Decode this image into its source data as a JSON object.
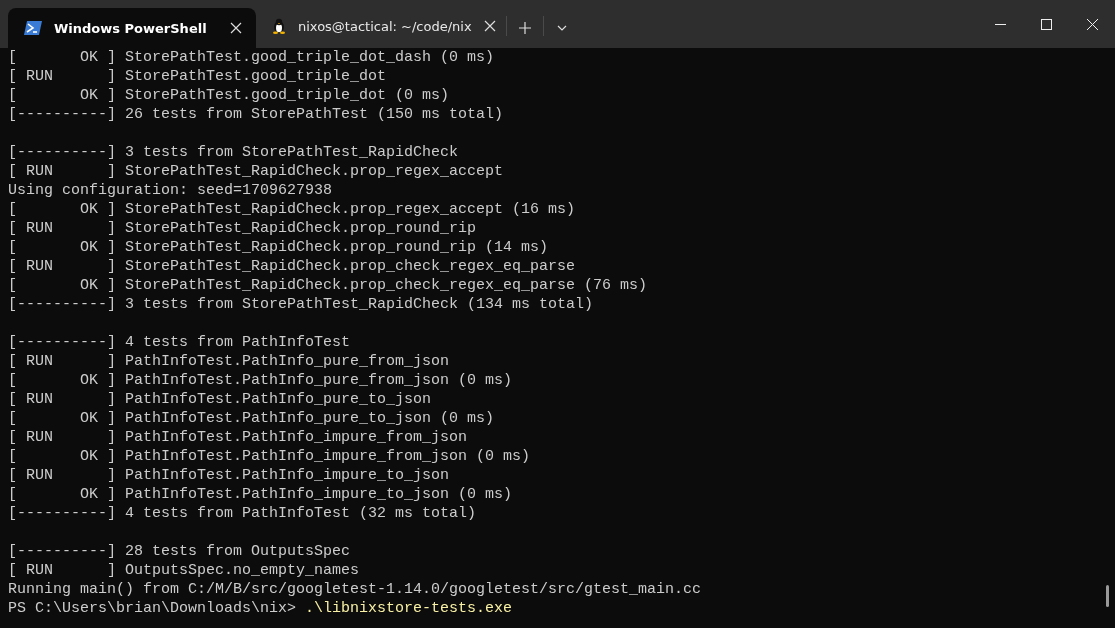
{
  "tabs": [
    {
      "title": "Windows PowerShell",
      "kind": "powershell",
      "selected": true
    },
    {
      "title": "nixos@tactical: ~/code/nix",
      "kind": "linux",
      "selected": false
    }
  ],
  "terminal": {
    "lines": [
      {
        "kind": "output",
        "text": "[       OK ] StorePathTest.good_triple_dot_dash (0 ms)"
      },
      {
        "kind": "output",
        "text": "[ RUN      ] StorePathTest.good_triple_dot"
      },
      {
        "kind": "output",
        "text": "[       OK ] StorePathTest.good_triple_dot (0 ms)"
      },
      {
        "kind": "output",
        "text": "[----------] 26 tests from StorePathTest (150 ms total)"
      },
      {
        "kind": "blank"
      },
      {
        "kind": "output",
        "text": "[----------] 3 tests from StorePathTest_RapidCheck"
      },
      {
        "kind": "output",
        "text": "[ RUN      ] StorePathTest_RapidCheck.prop_regex_accept"
      },
      {
        "kind": "output",
        "text": "Using configuration: seed=1709627938"
      },
      {
        "kind": "output",
        "text": "[       OK ] StorePathTest_RapidCheck.prop_regex_accept (16 ms)"
      },
      {
        "kind": "output",
        "text": "[ RUN      ] StorePathTest_RapidCheck.prop_round_rip"
      },
      {
        "kind": "output",
        "text": "[       OK ] StorePathTest_RapidCheck.prop_round_rip (14 ms)"
      },
      {
        "kind": "output",
        "text": "[ RUN      ] StorePathTest_RapidCheck.prop_check_regex_eq_parse"
      },
      {
        "kind": "output",
        "text": "[       OK ] StorePathTest_RapidCheck.prop_check_regex_eq_parse (76 ms)"
      },
      {
        "kind": "output",
        "text": "[----------] 3 tests from StorePathTest_RapidCheck (134 ms total)"
      },
      {
        "kind": "blank"
      },
      {
        "kind": "output",
        "text": "[----------] 4 tests from PathInfoTest"
      },
      {
        "kind": "output",
        "text": "[ RUN      ] PathInfoTest.PathInfo_pure_from_json"
      },
      {
        "kind": "output",
        "text": "[       OK ] PathInfoTest.PathInfo_pure_from_json (0 ms)"
      },
      {
        "kind": "output",
        "text": "[ RUN      ] PathInfoTest.PathInfo_pure_to_json"
      },
      {
        "kind": "output",
        "text": "[       OK ] PathInfoTest.PathInfo_pure_to_json (0 ms)"
      },
      {
        "kind": "output",
        "text": "[ RUN      ] PathInfoTest.PathInfo_impure_from_json"
      },
      {
        "kind": "output",
        "text": "[       OK ] PathInfoTest.PathInfo_impure_from_json (0 ms)"
      },
      {
        "kind": "output",
        "text": "[ RUN      ] PathInfoTest.PathInfo_impure_to_json"
      },
      {
        "kind": "output",
        "text": "[       OK ] PathInfoTest.PathInfo_impure_to_json (0 ms)"
      },
      {
        "kind": "output",
        "text": "[----------] 4 tests from PathInfoTest (32 ms total)"
      },
      {
        "kind": "blank"
      },
      {
        "kind": "output",
        "text": "[----------] 28 tests from OutputsSpec"
      },
      {
        "kind": "output",
        "text": "[ RUN      ] OutputsSpec.no_empty_names"
      },
      {
        "kind": "output",
        "text": "Running main() from C:/M/B/src/googletest-1.14.0/googletest/src/gtest_main.cc"
      },
      {
        "kind": "prompt",
        "prompt": "PS C:\\Users\\brian\\Downloads\\nix>",
        "command": ".\\libnixstore-tests.exe"
      }
    ]
  }
}
